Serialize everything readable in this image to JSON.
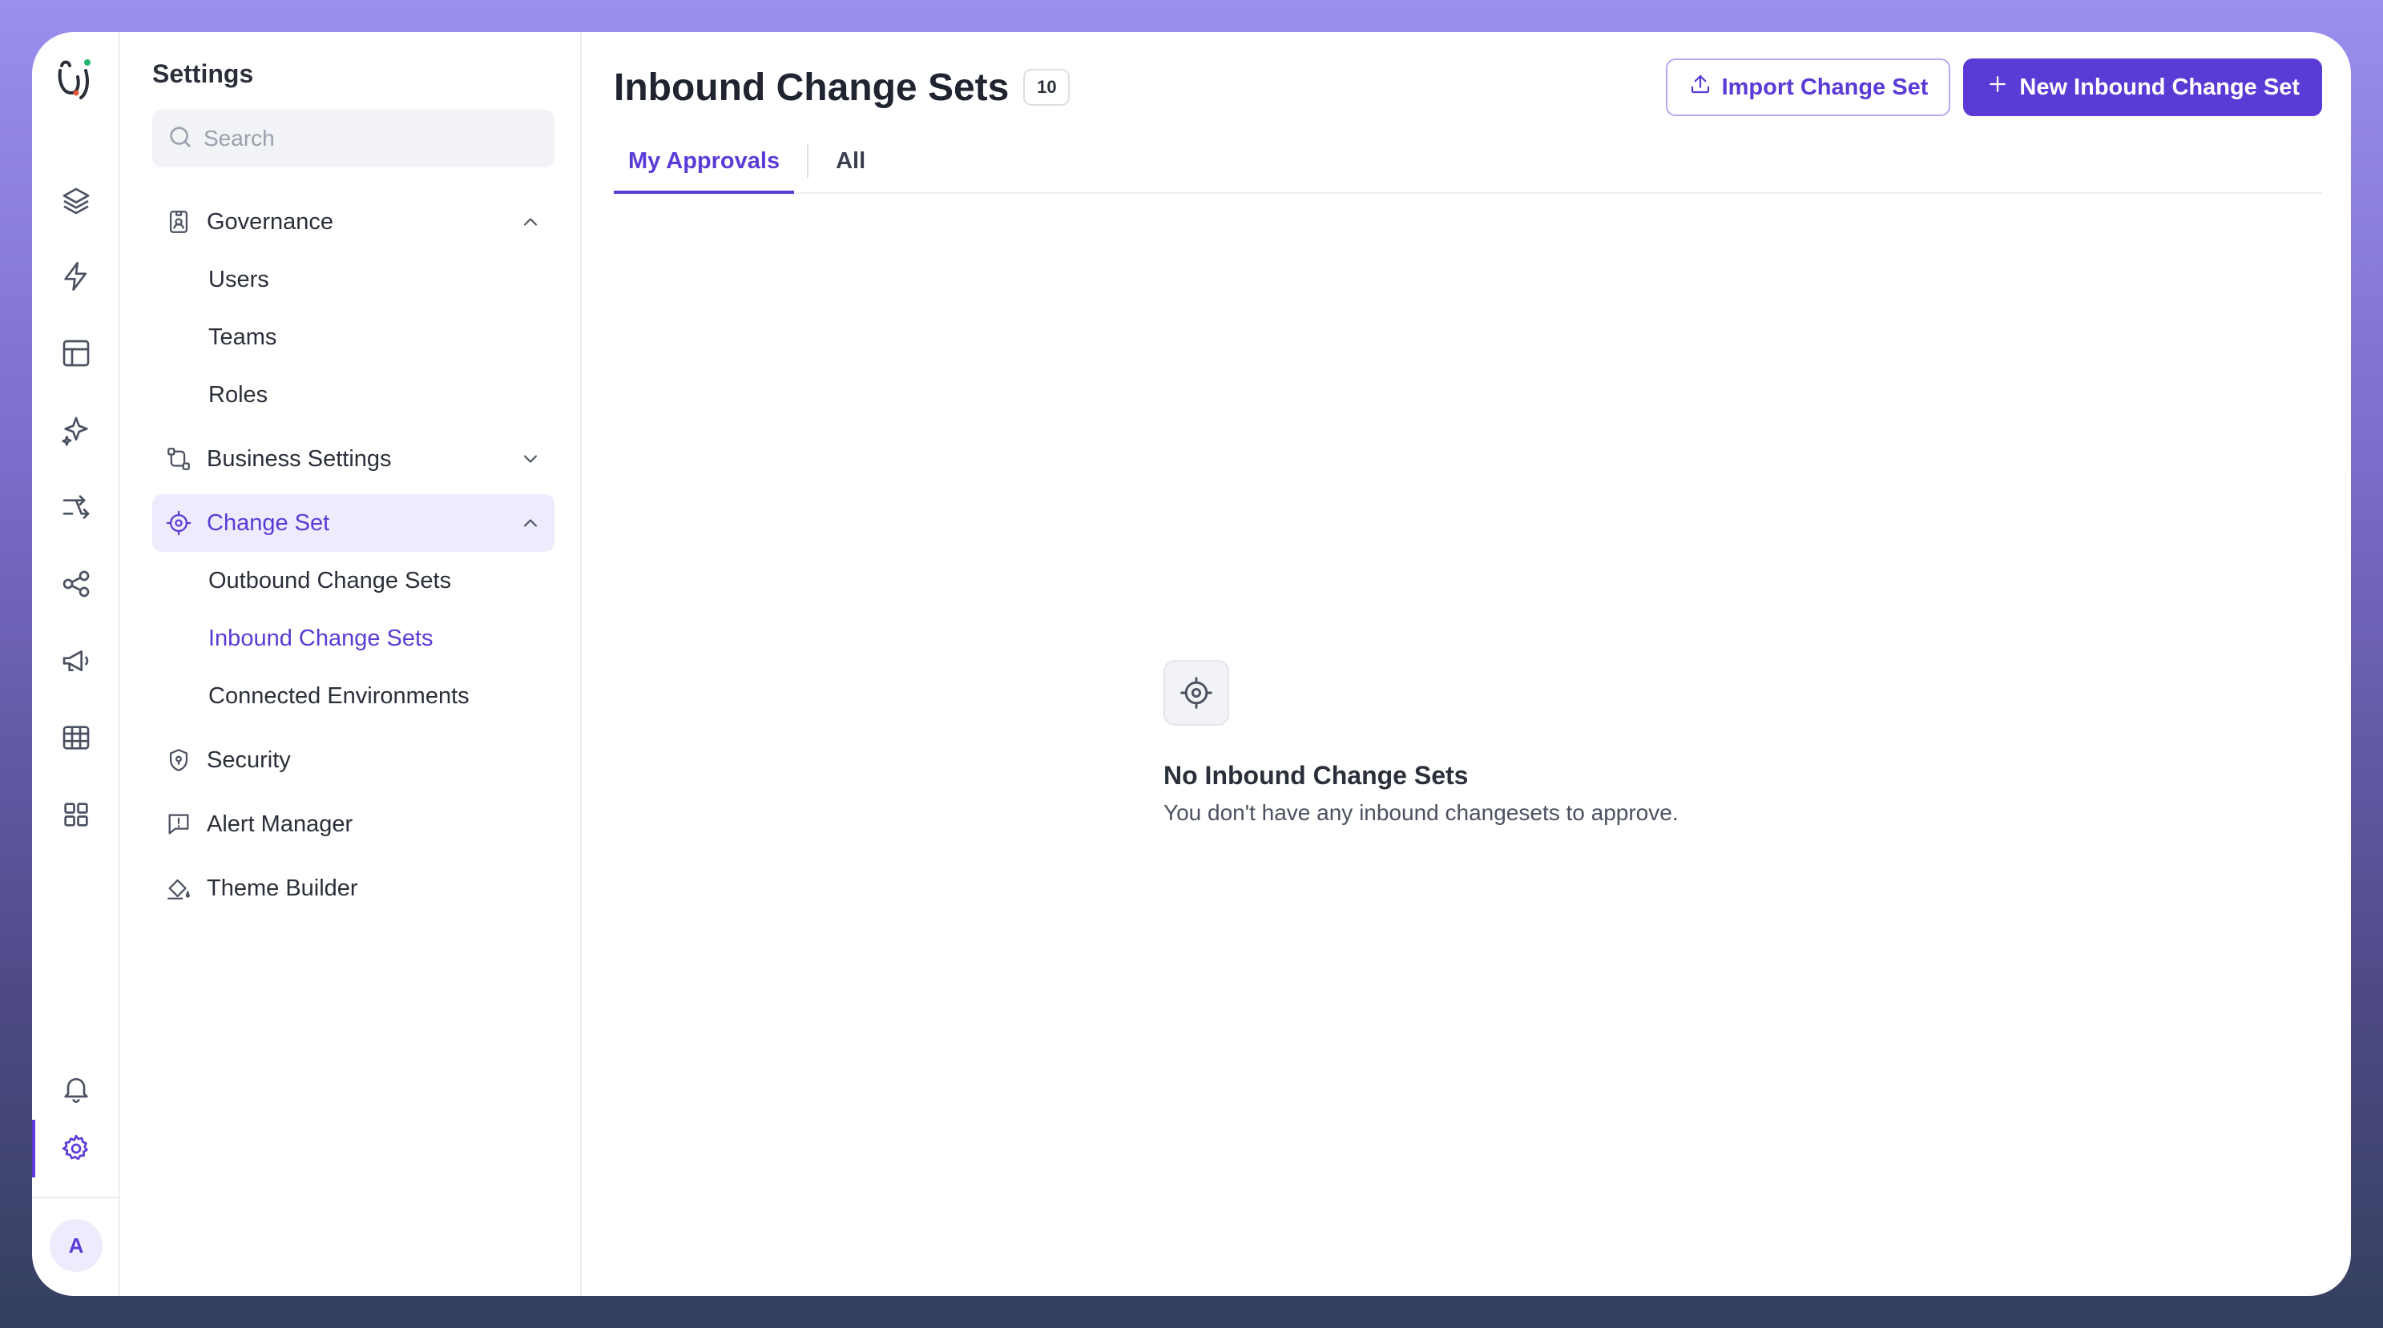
{
  "rail": {
    "items": [
      {
        "name": "layers-icon"
      },
      {
        "name": "lightning-icon"
      },
      {
        "name": "layout-icon"
      },
      {
        "name": "sparkles-icon"
      },
      {
        "name": "routing-icon"
      },
      {
        "name": "share-icon"
      },
      {
        "name": "megaphone-icon"
      },
      {
        "name": "table-icon"
      },
      {
        "name": "apps-grid-icon"
      },
      {
        "name": "bell-icon"
      },
      {
        "name": "gear-icon",
        "active": true
      }
    ],
    "avatar_initial": "A",
    "accent_color": "#5b3bd6"
  },
  "sidebar": {
    "title": "Settings",
    "search_placeholder": "Search",
    "governance": {
      "label": "Governance",
      "expanded": true,
      "items": [
        "Users",
        "Teams",
        "Roles"
      ]
    },
    "business_settings": {
      "label": "Business Settings",
      "expanded": false
    },
    "change_set": {
      "label": "Change Set",
      "expanded": true,
      "active": true,
      "items": [
        "Outbound Change Sets",
        "Inbound Change Sets",
        "Connected Environments"
      ],
      "active_item": "Inbound Change Sets"
    },
    "security": {
      "label": "Security"
    },
    "alert_manager": {
      "label": "Alert Manager"
    },
    "theme_builder": {
      "label": "Theme Builder"
    }
  },
  "main": {
    "title": "Inbound Change Sets",
    "count": "10",
    "import_button": "Import Change Set",
    "new_button": "New Inbound Change Set",
    "tabs": [
      {
        "label": "My Approvals",
        "active": true
      },
      {
        "label": "All",
        "active": false
      }
    ],
    "empty_state": {
      "icon": "target-icon",
      "title": "No Inbound Change Sets",
      "description": "You don't have any inbound changesets to approve."
    }
  }
}
